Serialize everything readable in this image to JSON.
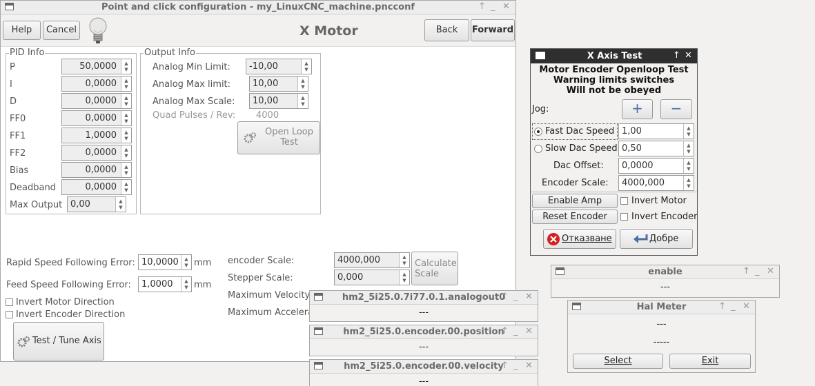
{
  "main": {
    "title": "Point and click configuration - my_LinuxCNC_machine.pncconf",
    "heading": "X Motor",
    "help": "Help",
    "cancel": "Cancel",
    "back": "Back",
    "forward": "Forward",
    "pid": {
      "label": "PID Info",
      "rows": [
        {
          "name": "P",
          "value": "50,0000"
        },
        {
          "name": "I",
          "value": "0,0000"
        },
        {
          "name": "D",
          "value": "0,0000"
        },
        {
          "name": "FF0",
          "value": "0,0000"
        },
        {
          "name": "FF1",
          "value": "1,0000"
        },
        {
          "name": "FF2",
          "value": "0,0000"
        },
        {
          "name": "Bias",
          "value": "0,0000"
        },
        {
          "name": "Deadband",
          "value": "0,0000"
        }
      ],
      "max_output_label": "Max Output",
      "max_output": "0,00"
    },
    "output": {
      "label": "Output Info",
      "min_label": "Analog Min Limit:",
      "min": "-10,00",
      "max_label": "Analog Max limit:",
      "max": "10,00",
      "scale_label": "Analog Max Scale:",
      "scale": "10,00",
      "quad_label": "Quad Pulses / Rev:",
      "quad": "4000",
      "openloop": "Open Loop Test"
    },
    "rapid_label": "Rapid Speed Following Error:",
    "rapid": "10,0000",
    "feed_label": "Feed Speed Following Error:",
    "feed": "1,0000",
    "unit": "mm",
    "invert_motor": "Invert Motor Direction",
    "invert_encoder": "Invert Encoder Direction",
    "test_tune": "Test / Tune Axis",
    "encoder_scale_label": "encoder Scale:",
    "encoder_scale": "4000,000",
    "stepper_scale_label": "Stepper Scale:",
    "stepper_scale": "0,000",
    "calc_scale": "Calculate Scale",
    "max_vel": "Maximum Velocity",
    "max_acc": "Maximum Accelera"
  },
  "axis_test": {
    "title": "X Axis Test",
    "line1": "Motor Encoder Openloop Test",
    "line2": "Warning limits switches",
    "line3": "Will not be obeyed",
    "jog": "Jog:",
    "plus": "+",
    "minus": "−",
    "fast_label": "Fast Dac Speed",
    "fast": "1,00",
    "slow_label": "Slow Dac Speed",
    "slow": "0,50",
    "offset_label": "Dac Offset:",
    "offset": "0,0000",
    "enc_label": "Encoder Scale:",
    "enc": "4000,000",
    "enable_amp": "Enable Amp",
    "invert_motor": "Invert Motor",
    "reset_encoder": "Reset Encoder",
    "invert_encoder": "Invert Encoder",
    "cancel": "Отказване",
    "ok": "Добре"
  },
  "meters": [
    {
      "title": "enable",
      "value": "---"
    },
    {
      "title": "hm2_5i25.0.7i77.0.1.analogout0",
      "value": "---"
    },
    {
      "title": "hm2_5i25.0.encoder.00.position",
      "value": "---"
    },
    {
      "title": "hm2_5i25.0.encoder.00.velocity",
      "value": "---"
    }
  ],
  "hal_meter": {
    "title": "Hal Meter",
    "value1": "---",
    "value2": "-----",
    "select": "Select",
    "exit": "Exit"
  }
}
